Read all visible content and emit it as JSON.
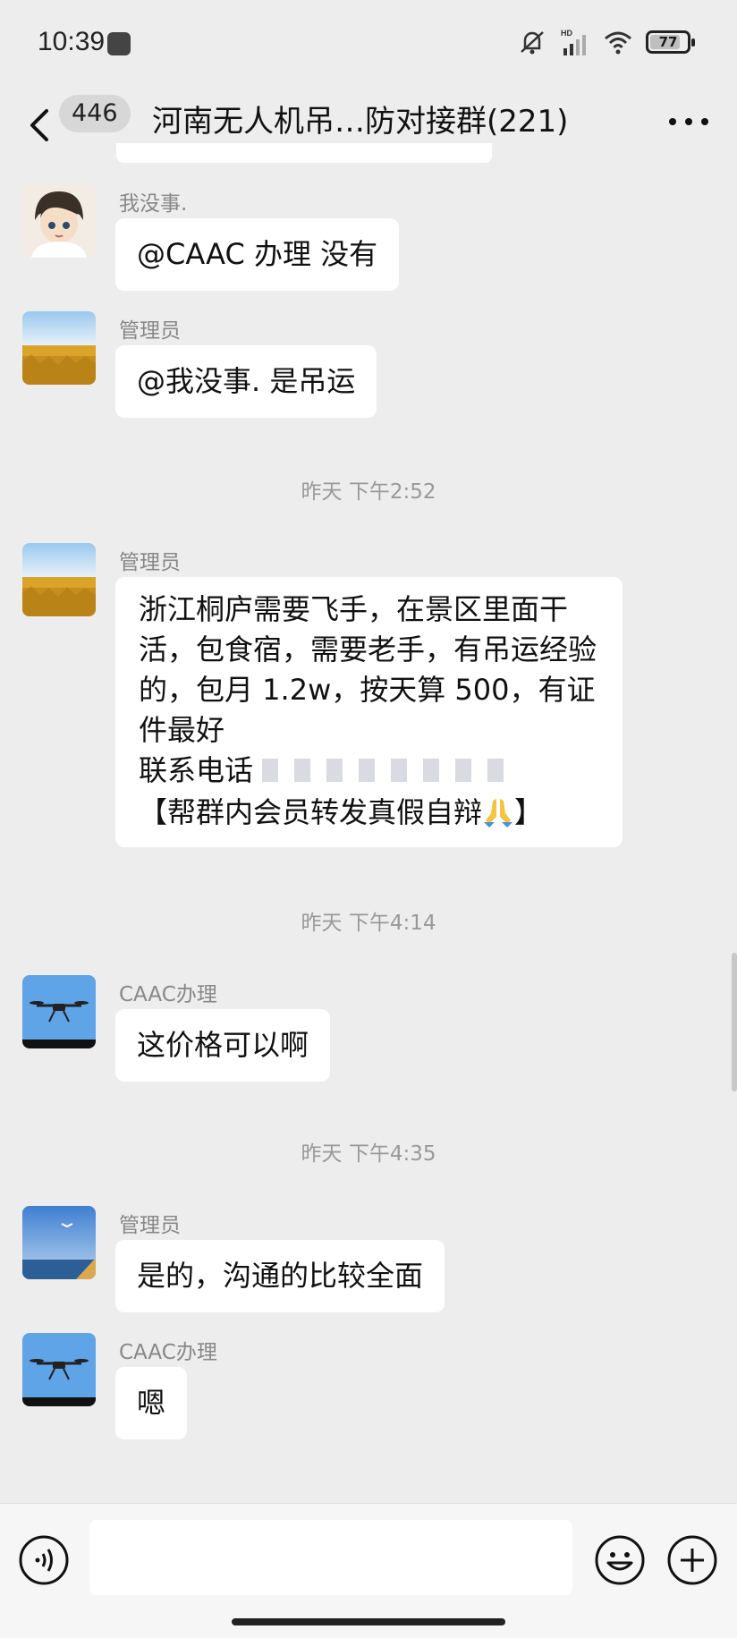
{
  "status_bar": {
    "time": "10:39",
    "battery": "77",
    "icons": [
      "mute-icon",
      "hd-signal-icon",
      "wifi-icon",
      "battery-icon"
    ]
  },
  "header": {
    "unread_count": "446",
    "title": "河南无人机吊…防对接群(221)"
  },
  "messages": [
    {
      "sender": "我没事.",
      "text": "@CAAC 办理  没有"
    },
    {
      "sender": "管理员",
      "text": "@我没事.  是吊运"
    },
    {
      "timestamp": "昨天 下午2:52"
    },
    {
      "sender": "管理员",
      "lines": [
        "浙江桐庐需要飞手，在景区里面干活，包食宿，需要老手，有吊运经验的，包月 1.2w，按天算 500，有证件最好",
        "联系电话",
        "【帮群内会员转发真假自辩",
        "】"
      ]
    },
    {
      "timestamp": "昨天 下午4:14"
    },
    {
      "sender": "CAAC办理",
      "text": "这价格可以啊"
    },
    {
      "timestamp": "昨天 下午4:35"
    },
    {
      "sender": "管理员",
      "text": "是的，沟通的比较全面"
    },
    {
      "sender": "CAAC办理",
      "text": "嗯"
    }
  ],
  "colors": {
    "background": "#ededed",
    "bubble": "#ffffff",
    "meta_text": "#999999"
  }
}
